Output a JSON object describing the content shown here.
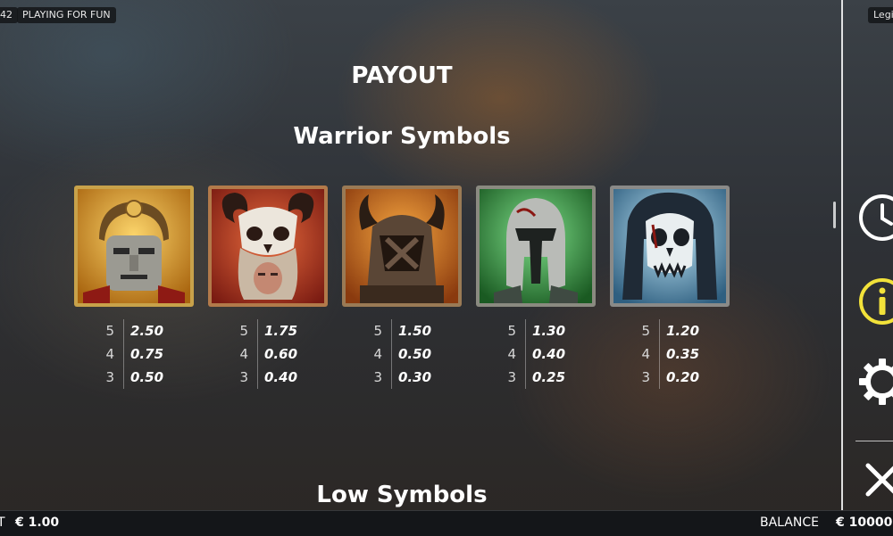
{
  "top": {
    "id_badge": "42",
    "mode_badge": "PLAYING FOR FUN",
    "title_badge": "Legio"
  },
  "payout": {
    "title": "PAYOUT",
    "section_title": "Warrior Symbols",
    "next_section_title": "Low Symbols"
  },
  "symbols": [
    {
      "icon": "golden-roman-helmet-icon",
      "frame_color": "#c8a24a",
      "payouts": [
        {
          "count": "5",
          "value": "2.50"
        },
        {
          "count": "4",
          "value": "0.75"
        },
        {
          "count": "3",
          "value": "0.50"
        }
      ]
    },
    {
      "icon": "ram-skull-warrior-icon",
      "frame_color": "#b27a4a",
      "payouts": [
        {
          "count": "5",
          "value": "1.75"
        },
        {
          "count": "4",
          "value": "0.60"
        },
        {
          "count": "3",
          "value": "0.40"
        }
      ]
    },
    {
      "icon": "horned-hooded-warrior-icon",
      "frame_color": "#9a7a55",
      "payouts": [
        {
          "count": "5",
          "value": "1.50"
        },
        {
          "count": "4",
          "value": "0.50"
        },
        {
          "count": "3",
          "value": "0.30"
        }
      ]
    },
    {
      "icon": "spartan-helmet-icon",
      "frame_color": "#8a8a80",
      "payouts": [
        {
          "count": "5",
          "value": "1.30"
        },
        {
          "count": "4",
          "value": "0.40"
        },
        {
          "count": "3",
          "value": "0.25"
        }
      ]
    },
    {
      "icon": "skull-mask-warrior-icon",
      "frame_color": "#8a8a88",
      "payouts": [
        {
          "count": "5",
          "value": "1.20"
        },
        {
          "count": "4",
          "value": "0.35"
        },
        {
          "count": "3",
          "value": "0.20"
        }
      ]
    }
  ],
  "side_menu": {
    "items": [
      "history-icon",
      "info-icon",
      "gear-icon",
      "close-icon"
    ],
    "info_color": "#f2e23a"
  },
  "bottom": {
    "bet_label": "T",
    "bet_value": "€ 1.00",
    "balance_label": "BALANCE",
    "balance_value": "€ 10000"
  }
}
